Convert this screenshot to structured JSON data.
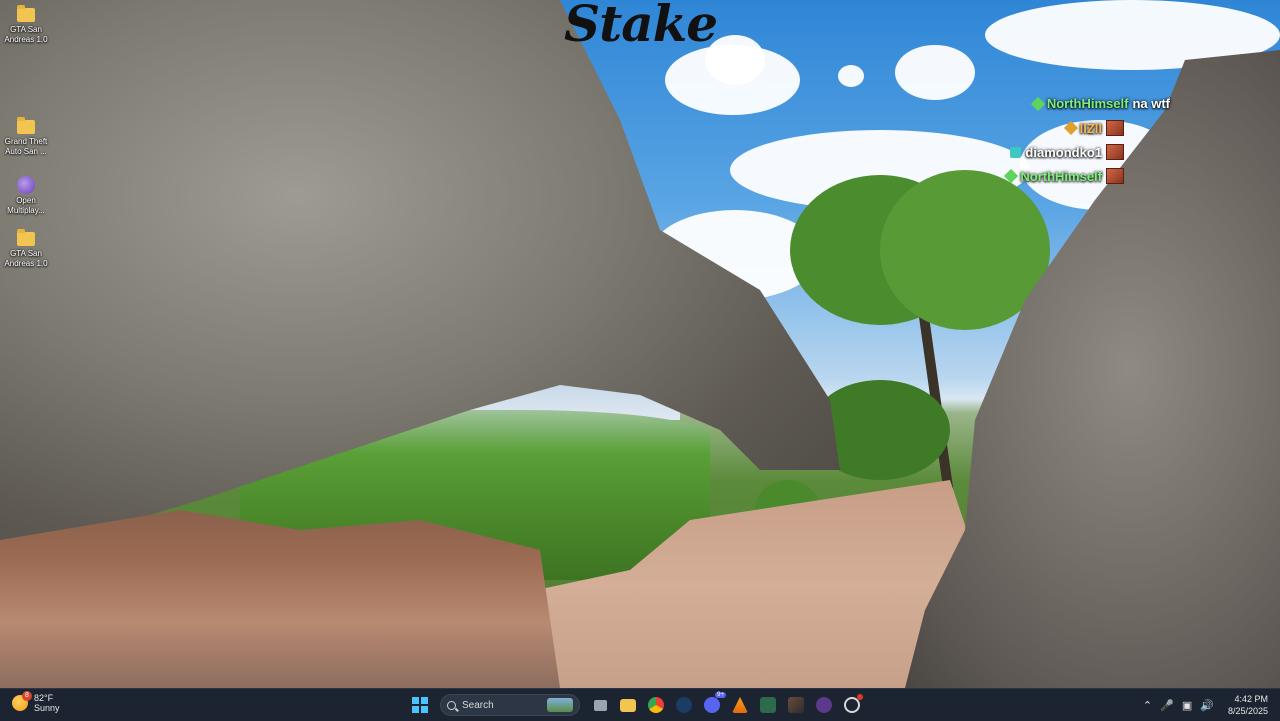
{
  "desktop": {
    "icons": [
      {
        "label": "GTA San Andreas 1.0",
        "icon": "folder-icon"
      },
      {
        "label": "Grand Theft Auto San ...",
        "icon": "folder-icon"
      },
      {
        "label": "Open Multiplay...",
        "icon": "samp-icon"
      },
      {
        "label": "GTA San Andreas 1.0",
        "icon": "folder-icon"
      }
    ]
  },
  "overlay": {
    "logo": "Stake",
    "chat": [
      {
        "user": "NorthHimself",
        "message": "na wtf",
        "badge": "green-diamond",
        "color": "#7df07a"
      },
      {
        "user": "llZll",
        "message": "",
        "badge": "orange-diamond",
        "color": "#ffb347"
      },
      {
        "user": "diamondko1",
        "message": "",
        "badge": "teal-square",
        "color": "#ffffff"
      },
      {
        "user": "NorthHimself",
        "message": "",
        "badge": "green-diamond",
        "color": "#7df07a"
      }
    ]
  },
  "taskbar": {
    "weather": {
      "temp": "82°F",
      "condition": "Sunny",
      "badge": "8"
    },
    "search_placeholder": "Search",
    "apps": [
      "file-explorer",
      "chrome",
      "steam",
      "discord",
      "vlc",
      "excel",
      "game",
      "obs",
      "clock"
    ],
    "discord_badge": "9+",
    "clock": {
      "time": "4:42 PM",
      "date": "8/25/2025"
    }
  },
  "colors": {
    "taskbar": "#1c2431",
    "accent": "#4cc2ff"
  }
}
